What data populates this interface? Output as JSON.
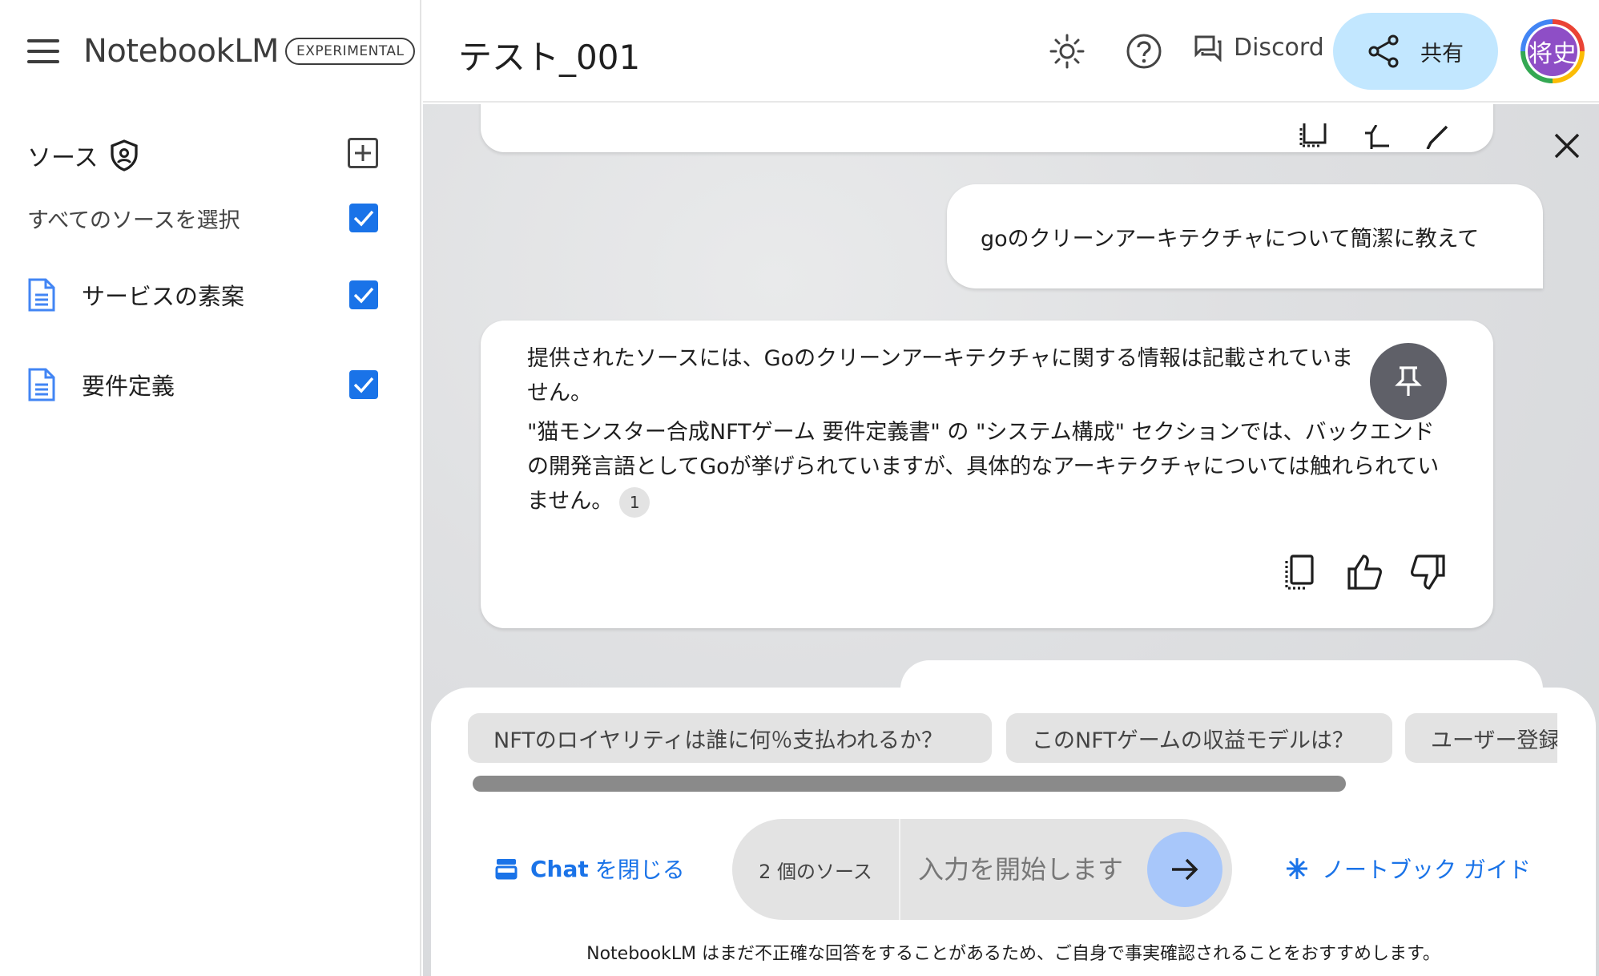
{
  "app": {
    "name": "NotebookLM",
    "badge": "EXPERIMENTAL"
  },
  "sidebar": {
    "sources_title": "ソース",
    "select_all": "すべてのソースを選択",
    "sources": [
      {
        "label": "サービスの素案",
        "checked": true
      },
      {
        "label": "要件定義",
        "checked": true
      }
    ]
  },
  "header": {
    "notebook_title": "テスト_001",
    "discord_label": "Discord",
    "share_label": "共有",
    "avatar_text": "将史"
  },
  "chat": {
    "user_message": "goのクリーンアーキテクチャについて簡潔に教えて",
    "answer_paragraphs": [
      "提供されたソースには、Goのクリーンアーキテクチャに関する情報は記載されていません。",
      "\"猫モンスター合成NFTゲーム 要件定義書\" の \"システム構成\" セクションでは、バックエンドの開発言語としてGoが挙げられていますが、具体的なアーキテクチャについては触れられていません。"
    ],
    "citation": "1"
  },
  "bottom": {
    "suggestions": [
      "NFTのロイヤリティは誰に何％支払われるか？",
      "このNFTゲームの収益モデルは？",
      "ユーザー登録"
    ],
    "close_chat_bold": "Chat",
    "close_chat_rest": "を閉じる",
    "source_count": "2 個のソース",
    "input_placeholder": "入力を開始します",
    "guide_label": "ノートブック ガイド",
    "disclaimer": "NotebookLM はまだ不正確な回答をすることがあるため、ご自身で事実確認されることをおすすめします。"
  },
  "colors": {
    "accent": "#1a73e8",
    "share_bg": "#c2e7ff",
    "send_bg": "#a8c7fa",
    "pin_bg": "#5f6068"
  },
  "icons": [
    "menu-icon",
    "shield-icon",
    "add-icon",
    "document-icon",
    "brightness-icon",
    "help-icon",
    "discord-icon",
    "share-icon",
    "close-icon",
    "pin-icon",
    "copy-icon",
    "thumb-up-icon",
    "thumb-down-icon",
    "chat-panel-icon",
    "send-arrow-icon",
    "sparkle-icon"
  ]
}
